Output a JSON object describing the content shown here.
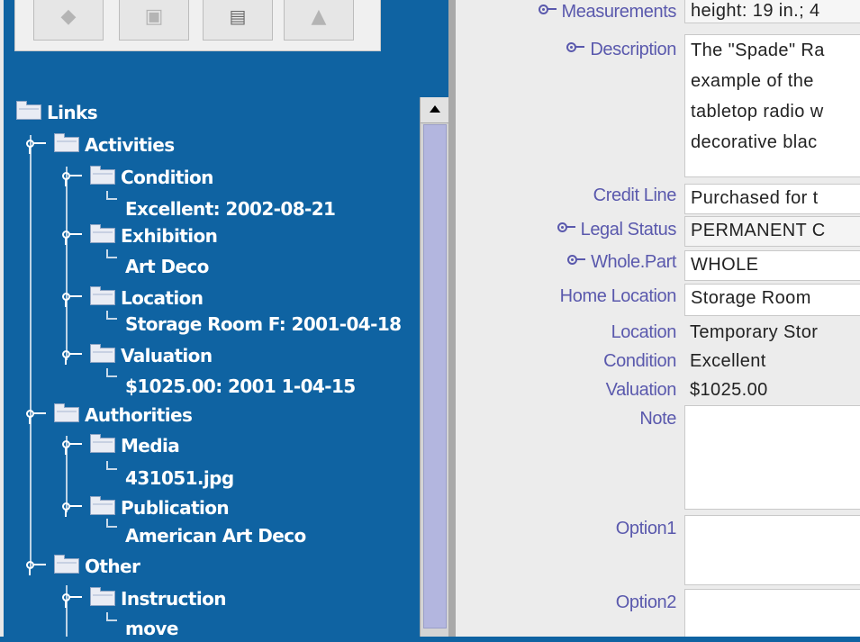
{
  "toolbar": {
    "buttons": [
      {
        "name": "toolbar-button-1",
        "icon": "comment-icon",
        "glyph": "◆"
      },
      {
        "name": "toolbar-button-2",
        "icon": "image-icon",
        "glyph": "▣"
      },
      {
        "name": "toolbar-button-3",
        "icon": "camera-icon",
        "glyph": "▤"
      },
      {
        "name": "toolbar-button-4",
        "icon": "hand-icon",
        "glyph": "▲"
      }
    ]
  },
  "tree": {
    "root": "Links",
    "groups": {
      "activities": "Activities",
      "condition": "Condition",
      "condition_leaf": "Excellent: 2002-08-21",
      "exhibition": "Exhibition",
      "exhibition_leaf": "Art Deco",
      "location": "Location",
      "location_leaf": "Storage Room F: 2001-04-18",
      "valuation": "Valuation",
      "valuation_leaf": "$1025.00: 2001 1-04-15",
      "authorities": "Authorities",
      "media": "Media",
      "media_leaf": "431051.jpg",
      "publication": "Publication",
      "publication_leaf": "American Art Deco",
      "other": "Other",
      "instruction": "Instruction",
      "instruction_leaf": "move"
    }
  },
  "record": {
    "measurements": {
      "label": "Measurements",
      "value": "height: 19 in.; 4"
    },
    "description": {
      "label": "Description",
      "value": "The \"Spade\" Ra\nexample of the\ntabletop radio w\ndecorative blac"
    },
    "credit_line": {
      "label": "Credit Line",
      "value": "Purchased for t"
    },
    "legal_status": {
      "label": "Legal Status",
      "value": "PERMANENT C"
    },
    "whole_part": {
      "label": "Whole.Part",
      "value": "WHOLE"
    },
    "home_location": {
      "label": "Home Location",
      "value": "Storage Room"
    },
    "location": {
      "label": "Location",
      "value": "Temporary Stor"
    },
    "condition": {
      "label": "Condition",
      "value": "Excellent"
    },
    "valuation": {
      "label": "Valuation",
      "value": "$1025.00"
    },
    "note": {
      "label": "Note",
      "value": ""
    },
    "option1": {
      "label": "Option1",
      "value": ""
    },
    "option2": {
      "label": "Option2",
      "value": ""
    }
  }
}
